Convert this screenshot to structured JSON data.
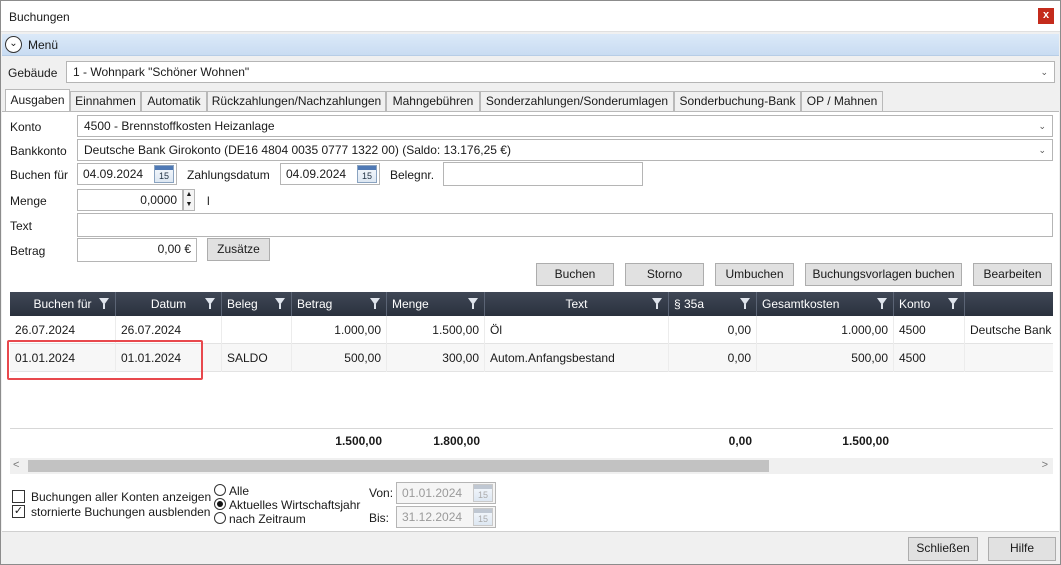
{
  "window": {
    "title": "Buchungen",
    "close_label": "x"
  },
  "menu": {
    "label": "Menü"
  },
  "building": {
    "label": "Gebäude",
    "value": "1 - Wohnpark \"Schöner Wohnen\""
  },
  "tabs": [
    {
      "label": "Ausgaben",
      "active": true
    },
    {
      "label": "Einnahmen"
    },
    {
      "label": "Automatik"
    },
    {
      "label": "Rückzahlungen/Nachzahlungen"
    },
    {
      "label": "Mahngebühren"
    },
    {
      "label": "Sonderzahlungen/Sonderumlagen"
    },
    {
      "label": "Sonderbuchung-Bank"
    },
    {
      "label": "OP / Mahnen"
    }
  ],
  "form": {
    "konto_label": "Konto",
    "konto_value": "4500 - Brennstoffkosten Heizanlage",
    "bankkonto_label": "Bankkonto",
    "bankkonto_value": "Deutsche Bank Girokonto (DE16 4804 0035 0777 1322 00) (Saldo: 13.176,25 €)",
    "buchen_fuer_label": "Buchen für",
    "buchen_fuer_value": "04.09.2024",
    "zahlungsdatum_label": "Zahlungsdatum",
    "zahlungsdatum_value": "04.09.2024",
    "belegnr_label": "Belegnr.",
    "belegnr_value": "",
    "menge_label": "Menge",
    "menge_value": "0,0000",
    "menge_unit": "l",
    "text_label": "Text",
    "text_value": "",
    "betrag_label": "Betrag",
    "betrag_value": "0,00 €",
    "zusaetze_label": "Zusätze",
    "calendar_glyph": "15"
  },
  "actions": {
    "buchen": "Buchen",
    "storno": "Storno",
    "umbuchen": "Umbuchen",
    "vorlagen": "Buchungsvorlagen buchen",
    "bearbeiten": "Bearbeiten"
  },
  "table": {
    "columns": [
      "Buchen für",
      "Datum",
      "Beleg",
      "Betrag",
      "Menge",
      "Text",
      "§ 35a",
      "Gesamtkosten",
      "Konto",
      ""
    ],
    "rows": [
      [
        "26.07.2024",
        "26.07.2024",
        "",
        "1.000,00",
        "1.500,00",
        "Öl",
        "0,00",
        "1.000,00",
        "4500",
        "Deutsche Bank G"
      ],
      [
        "01.01.2024",
        "01.01.2024",
        "SALDO",
        "500,00",
        "300,00",
        "Autom.Anfangsbestand",
        "0,00",
        "500,00",
        "4500",
        ""
      ]
    ],
    "totals": {
      "betrag": "1.500,00",
      "menge": "1.800,00",
      "s35a": "0,00",
      "gesamtkosten": "1.500,00"
    }
  },
  "filters": {
    "alle_konten": "Buchungen aller Konten anzeigen",
    "storniert": "stornierte Buchungen ausblenden",
    "radio_alle": "Alle",
    "radio_wj": "Aktuelles Wirtschaftsjahr",
    "radio_zeitraum": "nach Zeitraum",
    "von_label": "Von:",
    "von_value": "01.01.2024",
    "bis_label": "Bis:",
    "bis_value": "31.12.2024",
    "check_mark": "✓"
  },
  "footer": {
    "schliessen": "Schließen",
    "hilfe": "Hilfe"
  },
  "icons": {
    "menu_chevron": "⌄",
    "dropdown_arrow": "⌄",
    "spin_up": "▲",
    "spin_down": "▼",
    "scroll_left": "<",
    "scroll_right": ">"
  }
}
